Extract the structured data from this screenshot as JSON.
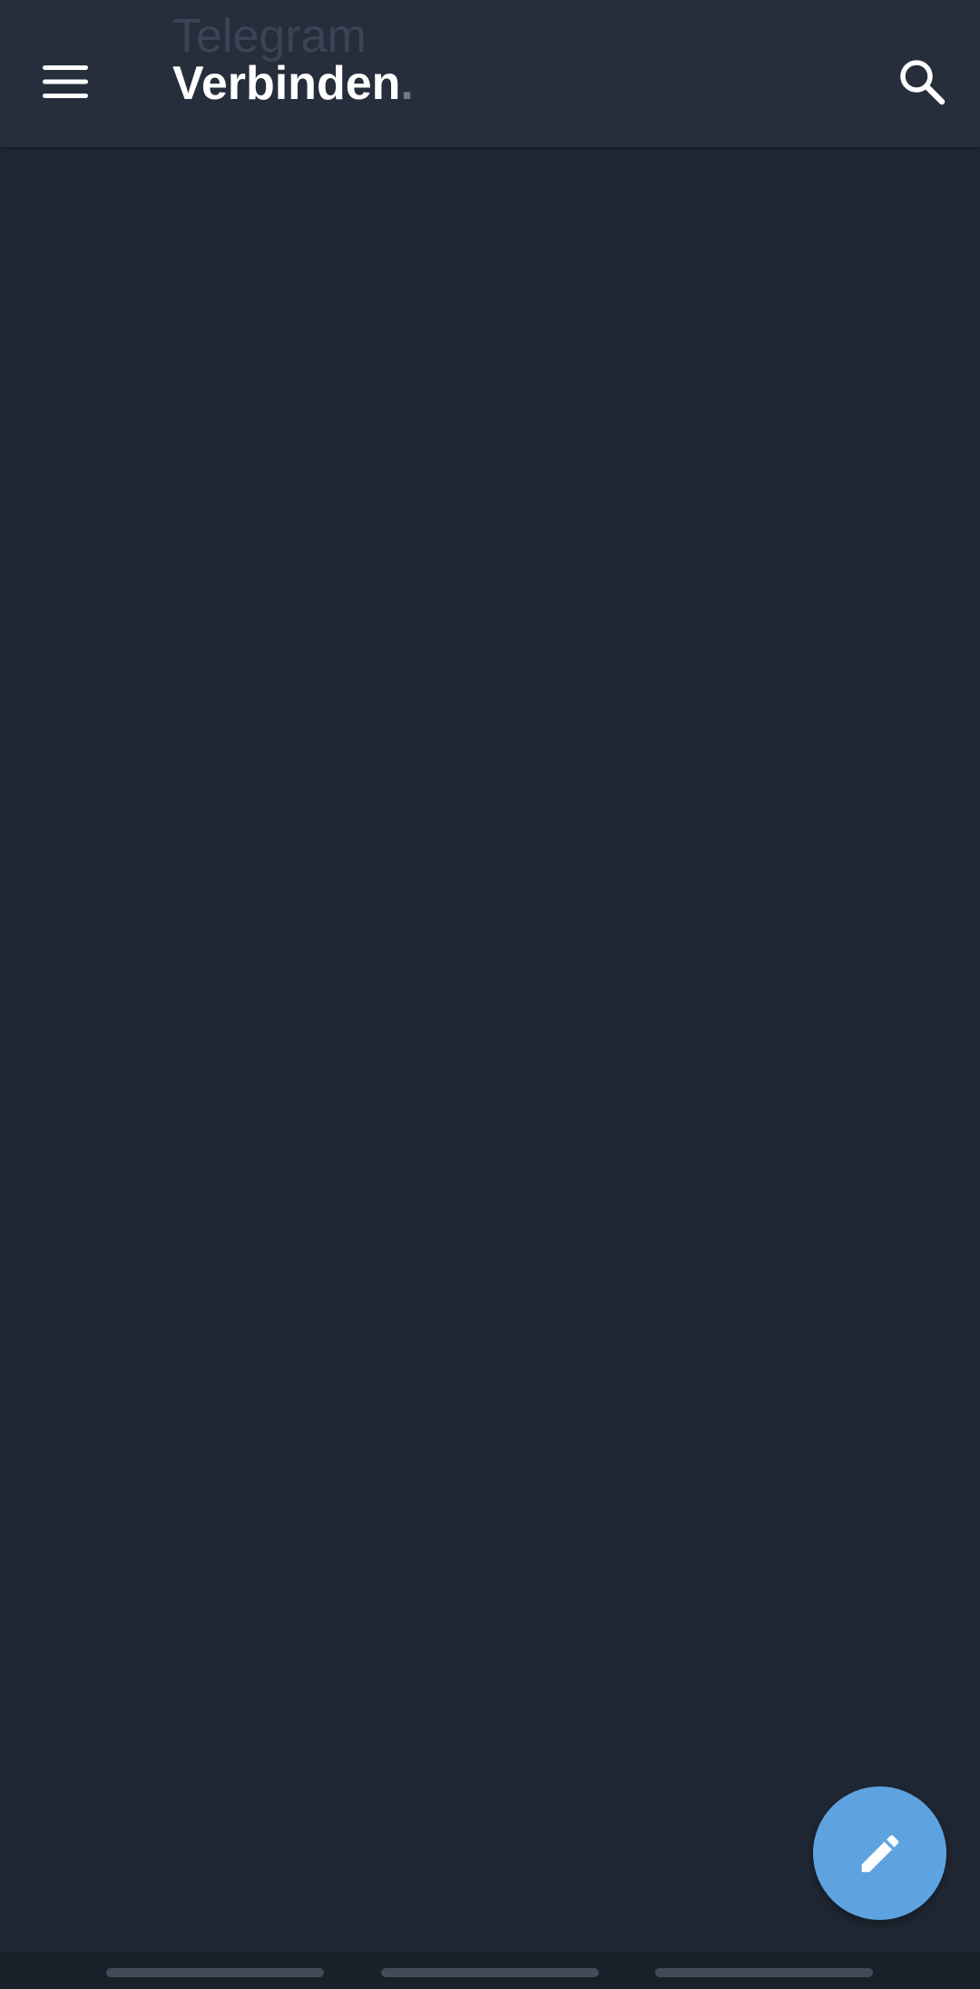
{
  "header": {
    "title_faded": "Telegram",
    "title_main": "Verbinden",
    "title_suffix": ".",
    "menu_icon": "hamburger-menu-icon",
    "search_icon": "search-icon"
  },
  "fab": {
    "icon": "pencil-icon"
  },
  "theme": {
    "background": "#1f2733",
    "header_background": "#262d3b",
    "accent": "#5ea3e0",
    "text": "#ffffff"
  }
}
